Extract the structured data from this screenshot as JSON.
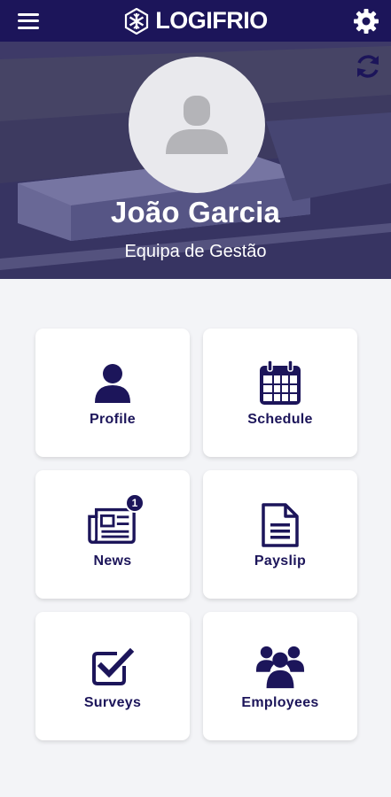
{
  "header": {
    "brand": "LOGIFRIO",
    "menu_icon": "hamburger-icon",
    "settings_icon": "gear-icon",
    "brand_color": "#1c155a"
  },
  "hero": {
    "refresh_icon": "refresh-icon",
    "avatar_icon": "user-placeholder-icon",
    "user_name": "João Garcia",
    "team": "Equipa de Gestão"
  },
  "tiles": [
    {
      "label": "Profile",
      "icon": "user-icon"
    },
    {
      "label": "Schedule",
      "icon": "calendar-icon"
    },
    {
      "label": "News",
      "icon": "newspaper-icon",
      "badge": "1"
    },
    {
      "label": "Payslip",
      "icon": "document-icon"
    },
    {
      "label": "Surveys",
      "icon": "checkbox-icon"
    },
    {
      "label": "Employees",
      "icon": "users-group-icon"
    }
  ]
}
